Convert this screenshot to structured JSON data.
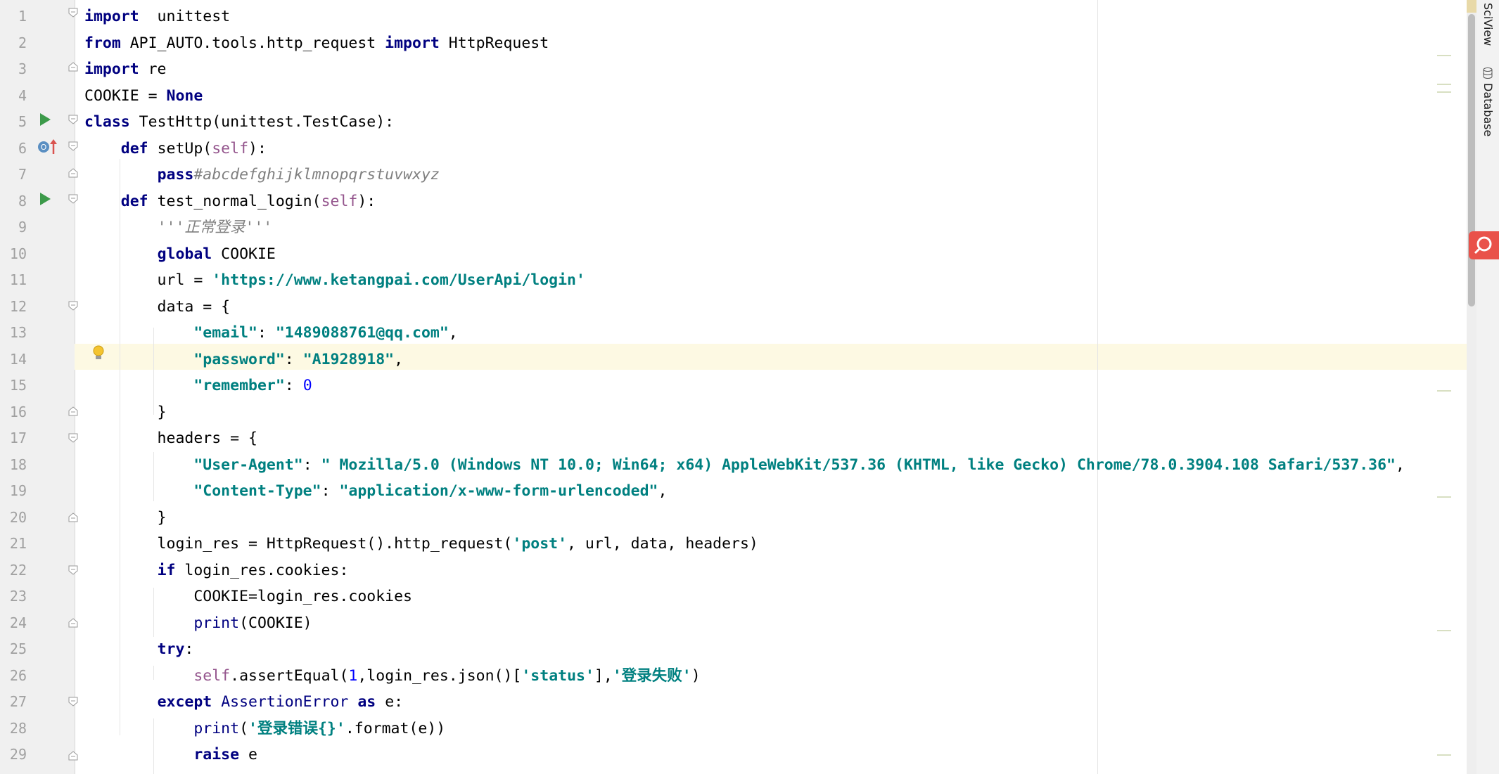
{
  "editor": {
    "lines": [
      {
        "n": "1",
        "tokens": [
          [
            "kw",
            "import"
          ],
          [
            "",
            "  unittest"
          ]
        ]
      },
      {
        "n": "2",
        "tokens": [
          [
            "kw",
            "from"
          ],
          [
            "",
            " API_AUTO.tools.http_request "
          ],
          [
            "kw",
            "import"
          ],
          [
            "",
            " HttpRequest"
          ]
        ]
      },
      {
        "n": "3",
        "tokens": [
          [
            "kw",
            "import"
          ],
          [
            "",
            " re"
          ]
        ]
      },
      {
        "n": "4",
        "tokens": [
          [
            "",
            "COOKIE = "
          ],
          [
            "kw",
            "None"
          ]
        ]
      },
      {
        "n": "5",
        "tokens": [
          [
            "kw",
            "class"
          ],
          [
            "",
            " TestHttp(unittest.TestCase):"
          ]
        ]
      },
      {
        "n": "6",
        "tokens": [
          [
            "",
            "    "
          ],
          [
            "kw",
            "def"
          ],
          [
            "",
            " setUp("
          ],
          [
            "slf",
            "self"
          ],
          [
            "",
            "):"
          ]
        ]
      },
      {
        "n": "7",
        "tokens": [
          [
            "",
            "        "
          ],
          [
            "kw",
            "pass"
          ],
          [
            "cmt",
            "#abcdefghijklmnopqrstuvwxyz"
          ]
        ]
      },
      {
        "n": "8",
        "tokens": [
          [
            "",
            "    "
          ],
          [
            "kw",
            "def"
          ],
          [
            "",
            " test_normal_login("
          ],
          [
            "slf",
            "self"
          ],
          [
            "",
            "):"
          ]
        ]
      },
      {
        "n": "9",
        "tokens": [
          [
            "",
            "        "
          ],
          [
            "docs",
            "'''正常登录'''"
          ]
        ]
      },
      {
        "n": "10",
        "tokens": [
          [
            "",
            "        "
          ],
          [
            "kw",
            "global"
          ],
          [
            "",
            " COOKIE"
          ]
        ]
      },
      {
        "n": "11",
        "tokens": [
          [
            "",
            "        url = "
          ],
          [
            "strk",
            "'https://www.ketangpai.com/UserApi/login'"
          ]
        ]
      },
      {
        "n": "12",
        "tokens": [
          [
            "",
            "        data = {"
          ]
        ]
      },
      {
        "n": "13",
        "tokens": [
          [
            "",
            "            "
          ],
          [
            "strk",
            "\"email\""
          ],
          [
            "",
            ": "
          ],
          [
            "strk",
            "\"1489088761@qq.com\""
          ],
          [
            "",
            ","
          ]
        ]
      },
      {
        "n": "14",
        "tokens": [
          [
            "",
            "            "
          ],
          [
            "strk",
            "\"password\""
          ],
          [
            "",
            ": "
          ],
          [
            "strk",
            "\"A1928918\""
          ],
          [
            "",
            ","
          ]
        ]
      },
      {
        "n": "15",
        "tokens": [
          [
            "",
            "            "
          ],
          [
            "strk",
            "\"remember\""
          ],
          [
            "",
            ": "
          ],
          [
            "num",
            "0"
          ]
        ]
      },
      {
        "n": "16",
        "tokens": [
          [
            "",
            "        }"
          ]
        ]
      },
      {
        "n": "17",
        "tokens": [
          [
            "",
            "        headers = {"
          ]
        ]
      },
      {
        "n": "18",
        "tokens": [
          [
            "",
            "            "
          ],
          [
            "strk",
            "\"User-Agent\""
          ],
          [
            "",
            ": "
          ],
          [
            "strk",
            "\" Mozilla/5.0 (Windows NT 10.0; Win64; x64) AppleWebKit/537.36 (KHTML, like Gecko) Chrome/78.0.3904.108 Safari/537.36\""
          ],
          [
            "",
            ","
          ]
        ]
      },
      {
        "n": "19",
        "tokens": [
          [
            "",
            "            "
          ],
          [
            "strk",
            "\"Content-Type\""
          ],
          [
            "",
            ": "
          ],
          [
            "strk",
            "\"application/x-www-form-urlencoded\""
          ],
          [
            "",
            ","
          ]
        ]
      },
      {
        "n": "20",
        "tokens": [
          [
            "",
            "        }"
          ]
        ]
      },
      {
        "n": "21",
        "tokens": [
          [
            "",
            "        login_res = HttpRequest().http_request("
          ],
          [
            "strk",
            "'post'"
          ],
          [
            "",
            ", url, data, headers)"
          ]
        ]
      },
      {
        "n": "22",
        "tokens": [
          [
            "",
            "        "
          ],
          [
            "kw",
            "if"
          ],
          [
            "",
            " login_res.cookies:"
          ]
        ]
      },
      {
        "n": "23",
        "tokens": [
          [
            "",
            "            COOKIE=login_res.cookies"
          ]
        ]
      },
      {
        "n": "24",
        "tokens": [
          [
            "",
            "            "
          ],
          [
            "bi",
            "print"
          ],
          [
            "",
            "(COOKIE)"
          ]
        ]
      },
      {
        "n": "25",
        "tokens": [
          [
            "",
            "        "
          ],
          [
            "kw",
            "try"
          ],
          [
            "",
            ":"
          ]
        ]
      },
      {
        "n": "26",
        "tokens": [
          [
            "",
            "            "
          ],
          [
            "slf",
            "self"
          ],
          [
            "",
            ".assertEqual("
          ],
          [
            "num",
            "1"
          ],
          [
            "",
            ",login_res.json()["
          ],
          [
            "strk",
            "'status'"
          ],
          [
            "",
            "],"
          ],
          [
            "strk",
            "'登录失败'"
          ],
          [
            "",
            ")"
          ]
        ]
      },
      {
        "n": "27",
        "tokens": [
          [
            "",
            "        "
          ],
          [
            "kw",
            "except"
          ],
          [
            "",
            " "
          ],
          [
            "bi",
            "AssertionError"
          ],
          [
            "",
            " "
          ],
          [
            "kw",
            "as"
          ],
          [
            "",
            " e:"
          ]
        ]
      },
      {
        "n": "28",
        "tokens": [
          [
            "",
            "            "
          ],
          [
            "bi",
            "print"
          ],
          [
            "",
            "("
          ],
          [
            "strk",
            "'登录错误{}'"
          ],
          [
            "",
            ".format(e))"
          ]
        ]
      },
      {
        "n": "29",
        "tokens": [
          [
            "",
            "            "
          ],
          [
            "kw",
            "raise"
          ],
          [
            "",
            " e"
          ]
        ]
      }
    ]
  },
  "right_panel": {
    "tabs": [
      "SciView",
      "Database"
    ]
  },
  "colors": {
    "keyword": "#000080",
    "string": "#008080",
    "comment": "#808080",
    "self": "#94558d",
    "number": "#0000ff",
    "caret_row": "#fdf9e3",
    "search_button": "#e9524a"
  }
}
